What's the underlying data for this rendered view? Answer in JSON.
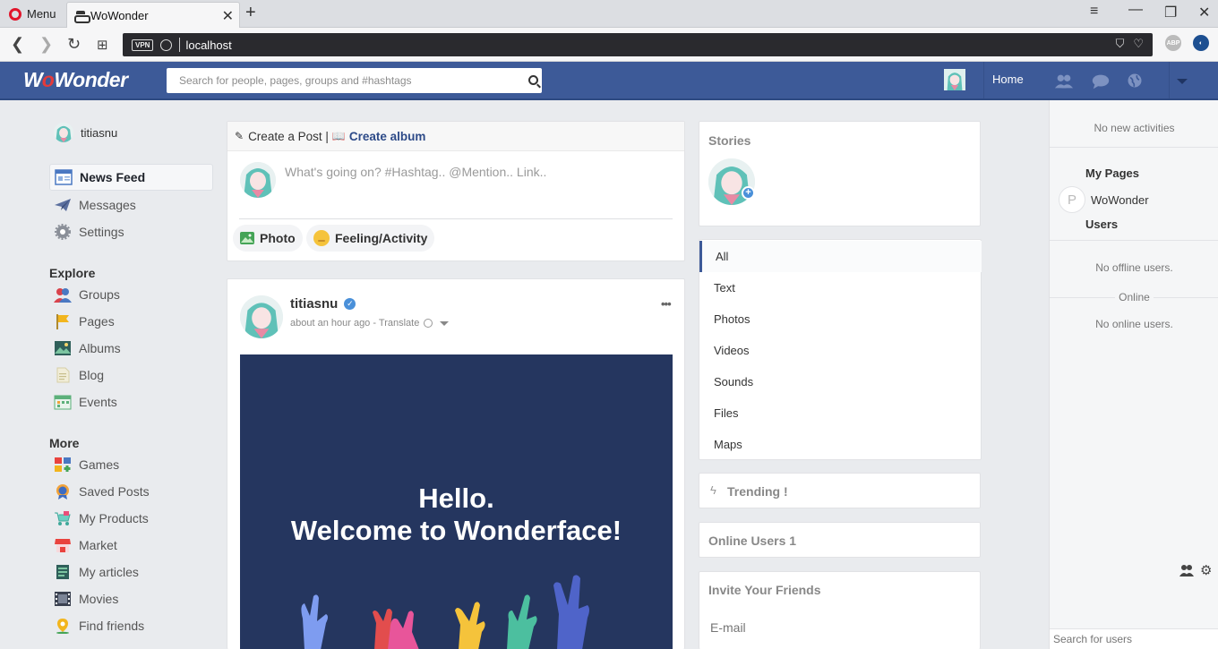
{
  "browser": {
    "menu_label": "Menu",
    "tab_title": "WoWonder",
    "url": "localhost",
    "vpn_badge": "VPN",
    "abp_badge": "ABP"
  },
  "header": {
    "logo_prefix": "W",
    "logo_o": "o",
    "logo_rest": "Wonder",
    "search_placeholder": "Search for people, pages, groups and #hashtags",
    "home_label": "Home"
  },
  "sidebar": {
    "username": "titiasnu",
    "main": [
      {
        "label": "News Feed",
        "icon": "news-feed-icon",
        "active": true
      },
      {
        "label": "Messages",
        "icon": "paper-plane-icon"
      },
      {
        "label": "Settings",
        "icon": "gear-icon"
      }
    ],
    "explore_title": "Explore",
    "explore": [
      {
        "label": "Groups",
        "icon": "groups-icon"
      },
      {
        "label": "Pages",
        "icon": "flag-icon"
      },
      {
        "label": "Albums",
        "icon": "image-icon"
      },
      {
        "label": "Blog",
        "icon": "document-icon"
      },
      {
        "label": "Events",
        "icon": "calendar-icon"
      }
    ],
    "more_title": "More",
    "more": [
      {
        "label": "Games",
        "icon": "games-icon"
      },
      {
        "label": "Saved Posts",
        "icon": "badge-icon"
      },
      {
        "label": "My Products",
        "icon": "cart-icon"
      },
      {
        "label": "Market",
        "icon": "store-icon"
      },
      {
        "label": "My articles",
        "icon": "articles-icon"
      },
      {
        "label": "Movies",
        "icon": "film-icon"
      },
      {
        "label": "Find friends",
        "icon": "location-pin-icon"
      }
    ]
  },
  "composer": {
    "create_post": "Create a Post |",
    "create_album": "Create album",
    "placeholder": "What's going on? #Hashtag.. @Mention.. Link..",
    "photo_label": "Photo",
    "feeling_label": "Feeling/Activity"
  },
  "post": {
    "author": "titiasnu",
    "meta": "about an hour ago - Translate",
    "image_line1": "Hello.",
    "image_line2": "Welcome to Wonderface!"
  },
  "right": {
    "stories_title": "Stories",
    "filters": [
      "All",
      "Text",
      "Photos",
      "Videos",
      "Sounds",
      "Files",
      "Maps"
    ],
    "trending_title": "Trending !",
    "online_users_title": "Online Users 1",
    "invite_title": "Invite Your Friends",
    "email_placeholder": "E-mail"
  },
  "chat": {
    "no_activities": "No new activities",
    "my_pages_title": "My Pages",
    "page_name": "WoWonder",
    "page_initial": "P",
    "users_title": "Users",
    "no_offline": "No offline users.",
    "online_label": "Online",
    "no_online": "No online users.",
    "search_placeholder": "Search for users"
  },
  "colors": {
    "header_blue": "#3d5a98",
    "post_image_bg": "#25365f",
    "link_blue": "#2d4a88"
  }
}
